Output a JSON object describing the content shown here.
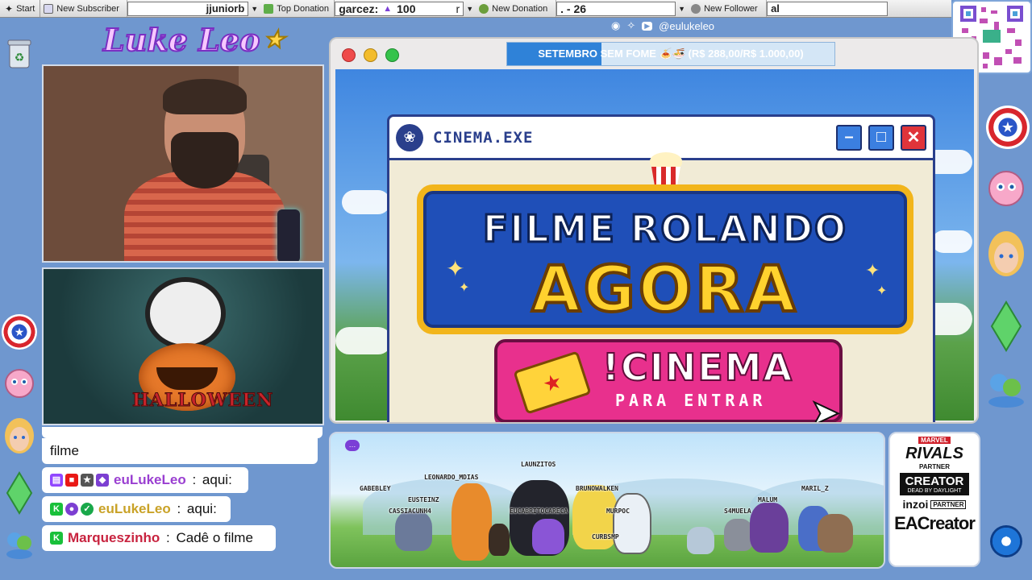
{
  "taskbar": {
    "start_label": "Start",
    "new_subscriber_label": "New Subscriber",
    "subscriber_value": "jjuniorb",
    "top_donation_label": "Top Donation",
    "top_donation_name": "garcez:",
    "top_donation_value": "100",
    "top_donation_suffix": "r",
    "new_donation_label": "New Donation",
    "new_donation_value": ". - 26",
    "new_follower_label": "New Follower",
    "new_follower_value": "al"
  },
  "logo": {
    "text": "Luke Leo"
  },
  "social": {
    "handle": "@eulukeleo"
  },
  "goal": {
    "text": "SETEMBRO SEM FOME 🍝🍜 (R$ 288,00/R$ 1.000,00)",
    "current": 288,
    "target": 1000,
    "progress": 0.288
  },
  "cinema": {
    "window_title": "CINEMA.EXE",
    "minimize": "–",
    "maximize": "□",
    "close": "✕",
    "headline_1": "FILME ROLANDO",
    "headline_2": "AGORA",
    "button_1": "!CINEMA",
    "button_2": "PARA ENTRAR"
  },
  "chat": {
    "messages": [
      {
        "user": "",
        "text": "filme"
      },
      {
        "user": "euLukeLeo",
        "sep": " : ",
        "text": "aqui:"
      },
      {
        "user": "euLukeLeo",
        "sep": " : ",
        "text": "aqui:"
      },
      {
        "user": "Marqueszinho",
        "sep": " : ",
        "text": "Cadê o filme"
      }
    ],
    "colors": {
      "purple_user": "#9a3fd1",
      "gold_user": "#c9a227",
      "red_user": "#c8233f"
    }
  },
  "halloween": {
    "title": "HALLOWEEN"
  },
  "scene": {
    "names": [
      "LAUNZITOS",
      "LEONARDO_MDIAS",
      "GABEBLEY",
      "EUSTEINZ",
      "CASSIACUNH4",
      "BRUNOWALKEN",
      "EUCABRITOCARECA",
      "MURPOC",
      "CURBSMP",
      "MALUM",
      "MARIL_Z",
      "S4MUELA"
    ]
  },
  "sponsors": {
    "marvel": "MARVEL",
    "rivals": "RIVALS",
    "rivals_partner": "PARTNER",
    "creator": "CREATOR",
    "creator_sub": "DEAD BY DAYLIGHT",
    "inzoi": "inzoi",
    "inzoi_partner": "PARTNER",
    "ea_creator": "EACreator"
  }
}
